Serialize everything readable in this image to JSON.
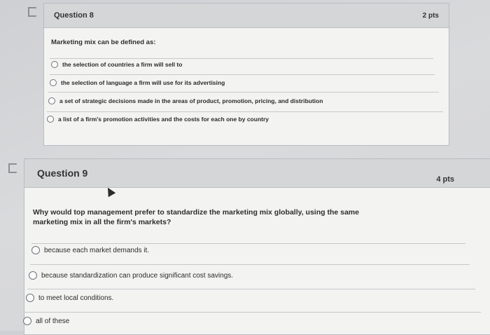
{
  "question8": {
    "title": "Question 8",
    "points": "2 pts",
    "prompt": "Marketing mix can be defined as:",
    "options": [
      "the selection of countries a firm will sell to",
      "the selection of language a firm will use for its advertising",
      "a set of strategic decisions made in the areas of product, promotion, pricing, and distribution",
      "a list of a firm's promotion activities and the costs for each one by country"
    ]
  },
  "question9": {
    "title": "Question 9",
    "points": "4 pts",
    "prompt_line1": "Why would top management prefer to standardize the marketing mix globally, using the same",
    "prompt_line2": "marketing mix in all the firm's markets?",
    "options": [
      "because each market demands it.",
      "because standardization can produce significant cost savings.",
      "to meet local conditions.",
      "all of these"
    ]
  },
  "icons": {
    "flag": "flag-icon",
    "radio": "radio-button",
    "cursor": "mouse-pointer-icon"
  }
}
